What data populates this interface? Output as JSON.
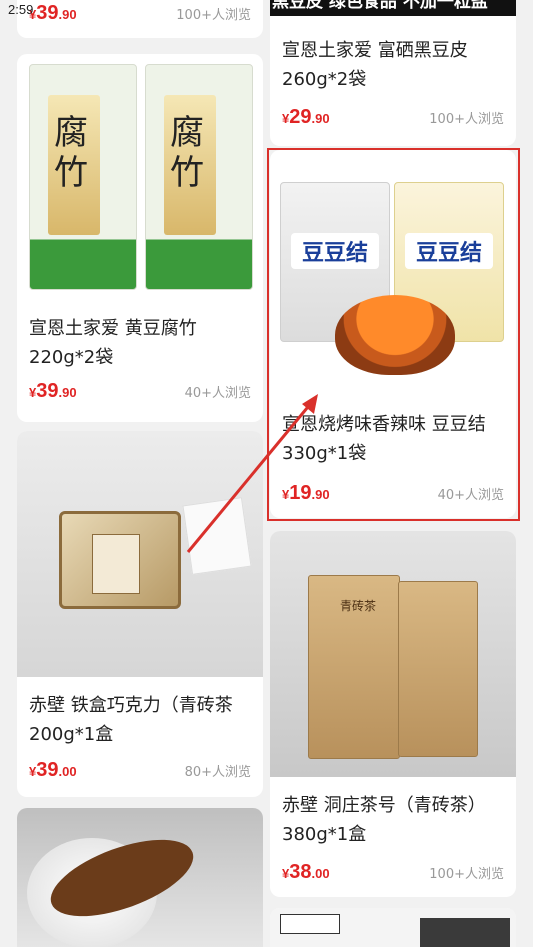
{
  "status_bar": {
    "time": "2:59"
  },
  "products": [
    {
      "id": "p0",
      "title": "",
      "price_symbol": "¥",
      "price_int": "39",
      "price_dec": ".90",
      "views": "100+人浏览"
    },
    {
      "id": "p1",
      "title": "宣恩土家爱 黄豆腐竹220g*2袋",
      "price_symbol": "¥",
      "price_int": "39",
      "price_dec": ".90",
      "views": "40+人浏览"
    },
    {
      "id": "p2",
      "title": "赤壁 铁盒巧克力（青砖茶 200g*1盒",
      "price_symbol": "¥",
      "price_int": "39",
      "price_dec": ".00",
      "views": "80+人浏览"
    },
    {
      "id": "p3",
      "title": "宣恩土家爱 富硒黑豆皮260g*2袋",
      "price_symbol": "¥",
      "price_int": "29",
      "price_dec": ".90",
      "views": "100+人浏览"
    },
    {
      "id": "p4",
      "title": "宣恩烧烤味香辣味 豆豆结330g*1袋",
      "price_symbol": "¥",
      "price_int": "19",
      "price_dec": ".90",
      "views": "40+人浏览"
    },
    {
      "id": "p5",
      "title": "赤壁 洞庄茶号（青砖茶） 380g*1盒",
      "price_symbol": "¥",
      "price_int": "38",
      "price_dec": ".00",
      "views": "100+人浏览"
    }
  ],
  "image_texts": {
    "banner": "黑豆皮 绿色食品 不加一粒盐",
    "fuzhu_label": "腐竹",
    "doudoujie_label": "豆豆结",
    "tea_label": "青砖茶"
  },
  "colors": {
    "price": "#e02424",
    "highlight": "#d9302b"
  }
}
